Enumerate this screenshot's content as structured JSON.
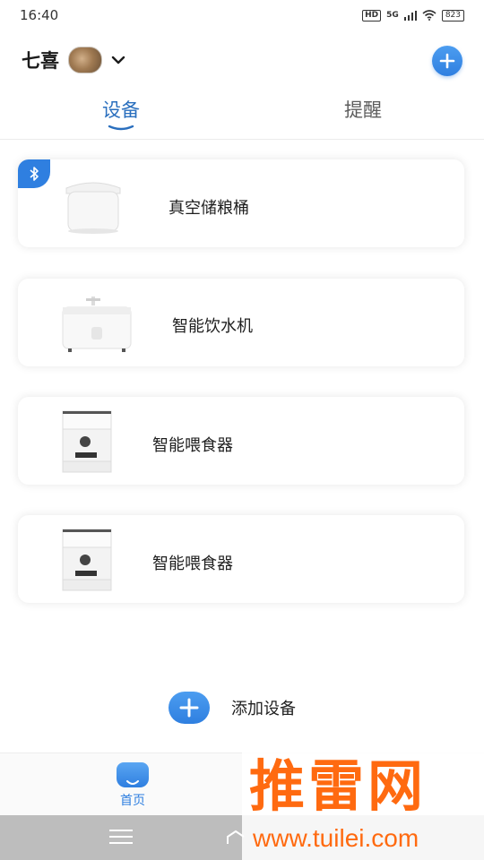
{
  "status_bar": {
    "time": "16:40",
    "hd": "HD",
    "network": "5G",
    "battery": "823"
  },
  "header": {
    "pet_name": "七喜"
  },
  "tabs": {
    "devices": "设备",
    "reminders": "提醒"
  },
  "devices": [
    {
      "name": "真空储粮桶",
      "bluetooth": true,
      "icon": "storage-bucket"
    },
    {
      "name": "智能饮水机",
      "bluetooth": false,
      "icon": "water-fountain"
    },
    {
      "name": "智能喂食器",
      "bluetooth": false,
      "icon": "pet-feeder"
    },
    {
      "name": "智能喂食器",
      "bluetooth": false,
      "icon": "pet-feeder"
    }
  ],
  "add_device": {
    "label": "添加设备"
  },
  "bottom_tab": {
    "home_label": "首页"
  },
  "watermark": {
    "brand": "推雷网",
    "url": "www.tuilei.com"
  },
  "colors": {
    "accent": "#2f7fe0",
    "tab_active": "#2a6fbe",
    "watermark": "#ff6a10"
  }
}
